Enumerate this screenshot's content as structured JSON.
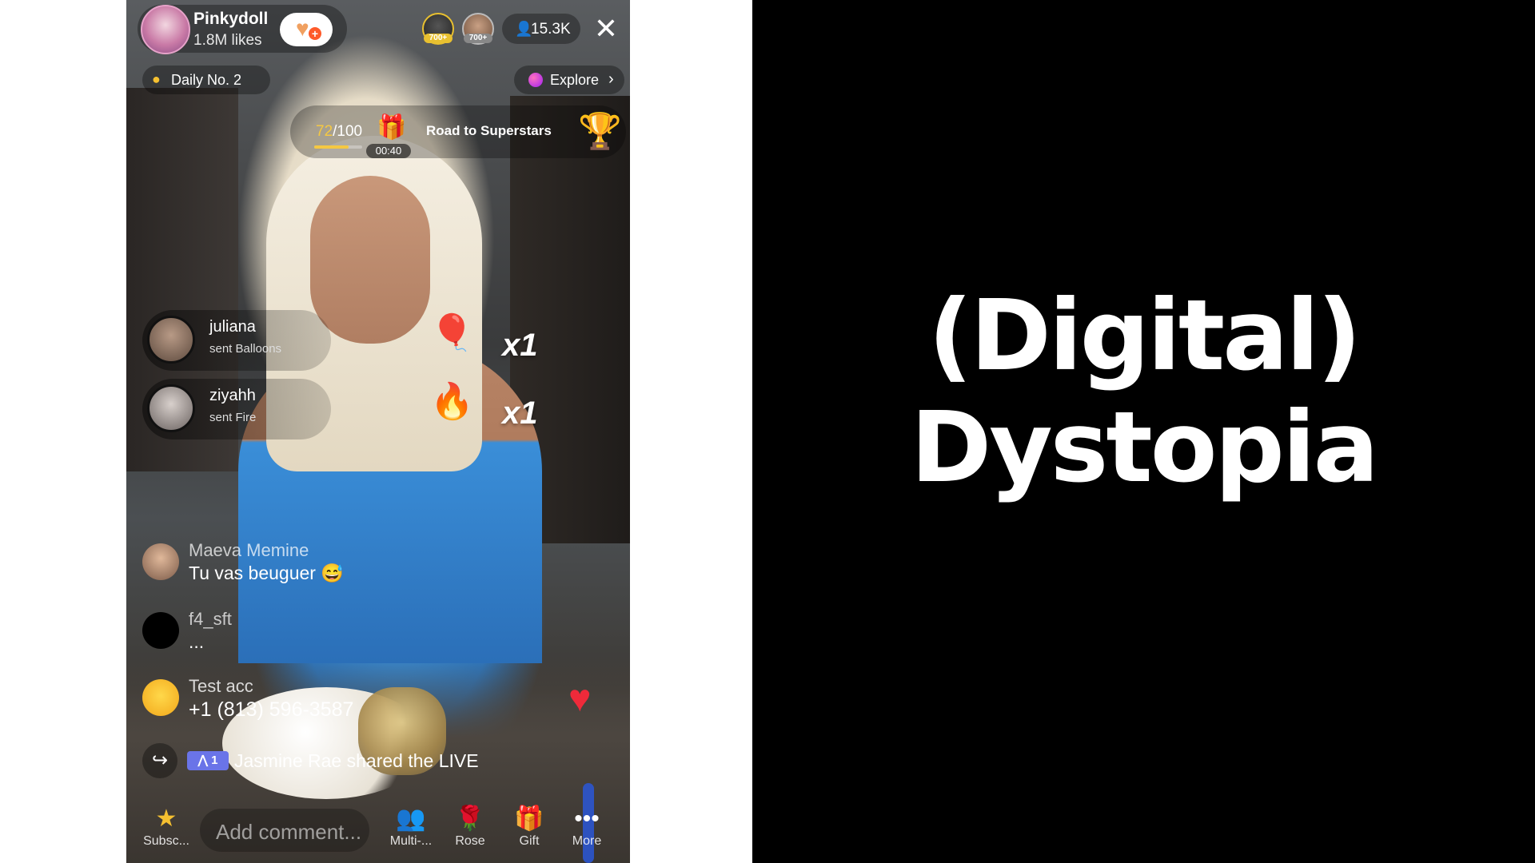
{
  "slide": {
    "title_line1": "(Digital)",
    "title_line2": "Dystopia"
  },
  "live": {
    "host": {
      "name": "Pinkydoll",
      "likes": "1.8M likes"
    },
    "viewers": {
      "badge1": "700+",
      "badge2": "700+",
      "count": "15.3K"
    },
    "daily": "Daily No. 2",
    "explore": "Explore",
    "progress": {
      "current": "72",
      "total": "/100",
      "fraction": 0.72,
      "timer": "00:40",
      "label": "Road to Superstars"
    },
    "gifts": [
      {
        "user": "juliana",
        "action": "sent Balloons",
        "count": "x1"
      },
      {
        "user": "ziyahh",
        "action": "sent Fire",
        "count": "x1"
      }
    ],
    "comments": [
      {
        "user": "Maeva Memine",
        "text": "Tu vas beuguer 😅"
      },
      {
        "user": "f4_sft",
        "text": "..."
      },
      {
        "user": "Test acc",
        "text": "+1 (813) 596-3587"
      }
    ],
    "share": {
      "badge": "1",
      "text": "Jasmine Rae shared the LIVE"
    },
    "bottom": {
      "subscribe": "Subsc...",
      "comment_placeholder": "Add comment...",
      "multi": "Multi-...",
      "rose": "Rose",
      "gift": "Gift",
      "more": "More"
    }
  },
  "icons": {
    "follow": "heart-plus-icon",
    "close": "close-icon",
    "daily": "flame-icon",
    "explore": "planet-icon",
    "trophy": "trophy-icon",
    "share": "share-arrow-icon",
    "float_heart": "heart-icon"
  },
  "colors": {
    "accent_pink": "#fe2c55",
    "progress_gold": "#f5c842",
    "share_badge": "#6a74e8"
  }
}
